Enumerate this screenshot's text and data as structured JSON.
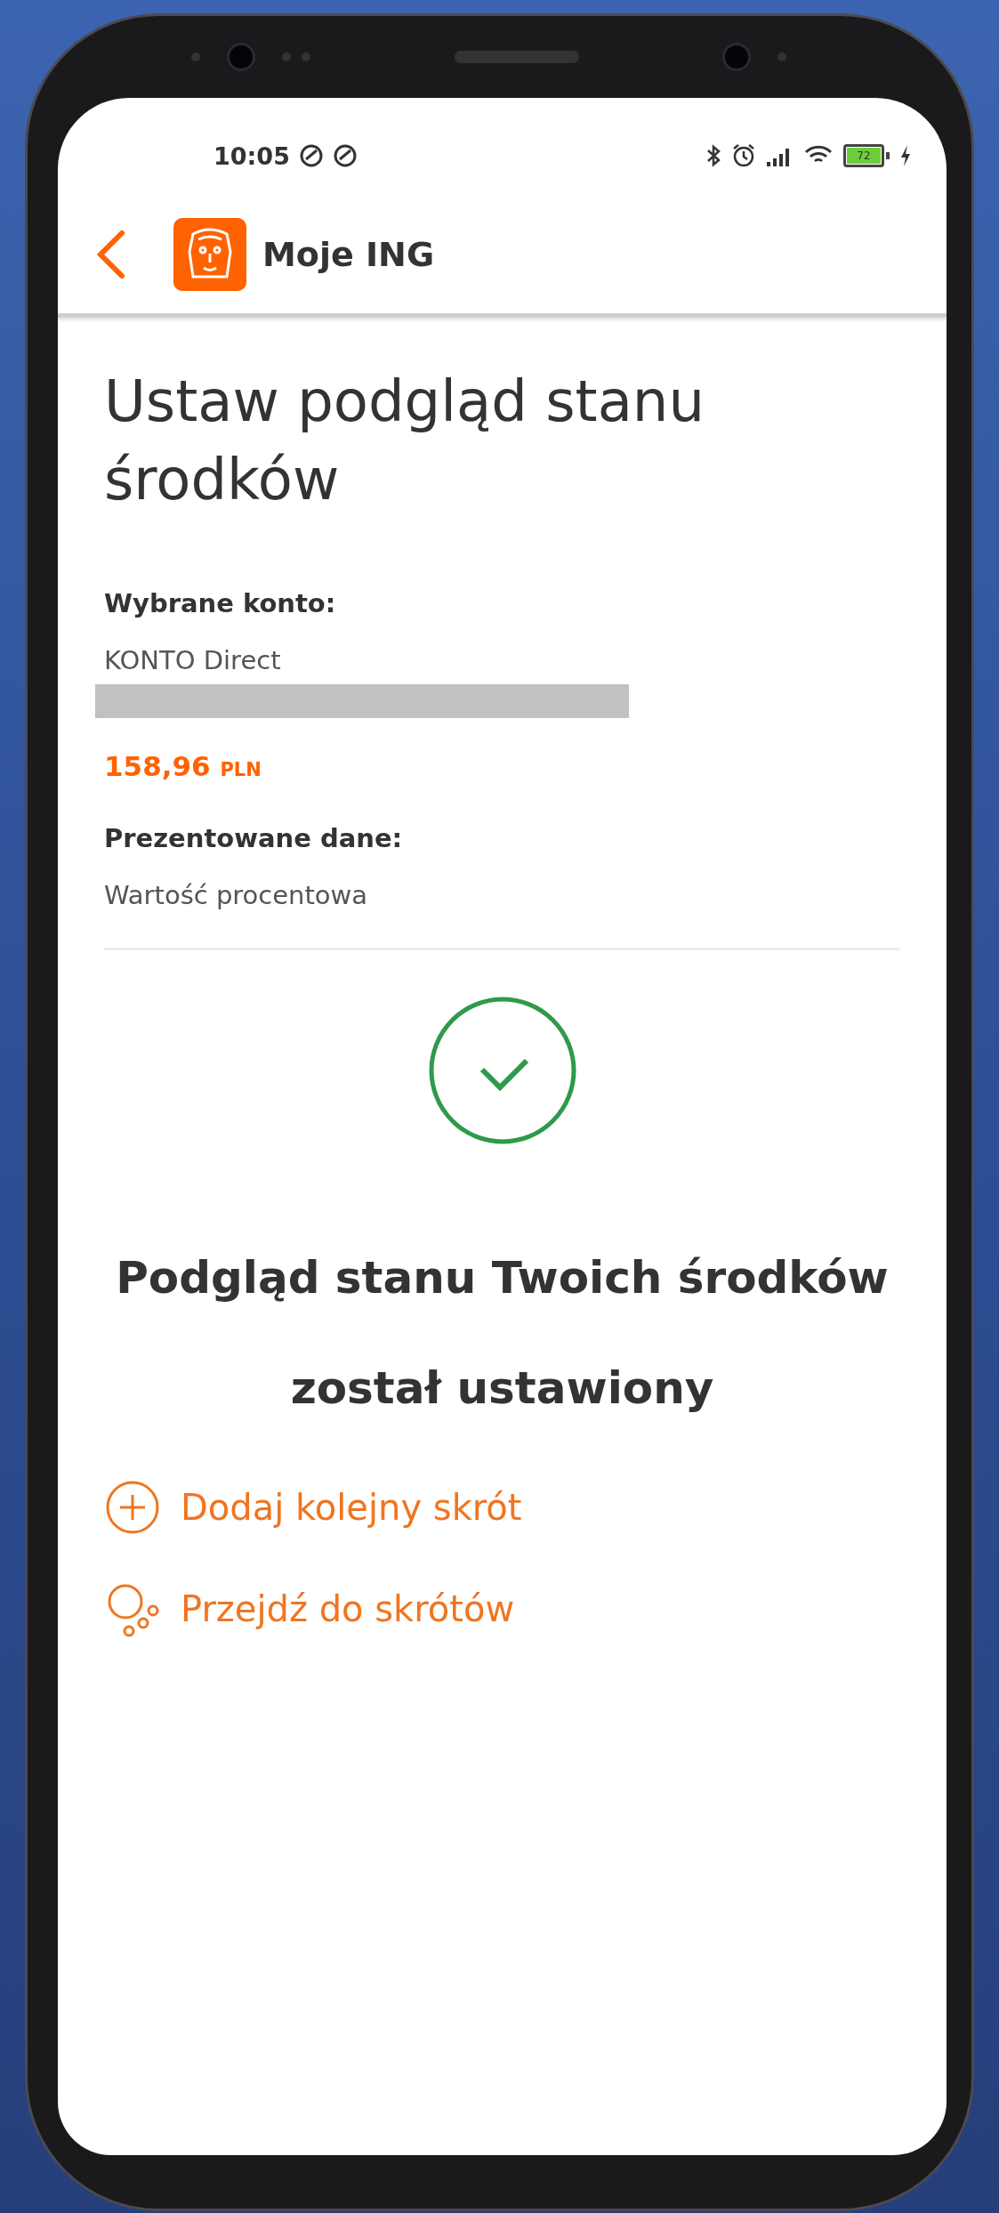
{
  "status_bar": {
    "time": "10:05",
    "battery": "72"
  },
  "header": {
    "title": "Moje ING"
  },
  "page": {
    "title": "Ustaw podgląd stanu środków",
    "fields": [
      {
        "label": "Wybrane konto:",
        "value": "KONTO Direct",
        "kind": "account",
        "amount": "158,96",
        "currency": "PLN"
      },
      {
        "label": "Prezentowane dane:",
        "value": "Wartość procentowa",
        "kind": "text"
      }
    ]
  },
  "success": {
    "message": "Podgląd stanu Twoich środków został ustawiony"
  },
  "actions": [
    {
      "label": "Dodaj kolejny skrót",
      "kind": "add"
    },
    {
      "label": "Przejdź do skrótów",
      "kind": "shortcuts"
    }
  ]
}
